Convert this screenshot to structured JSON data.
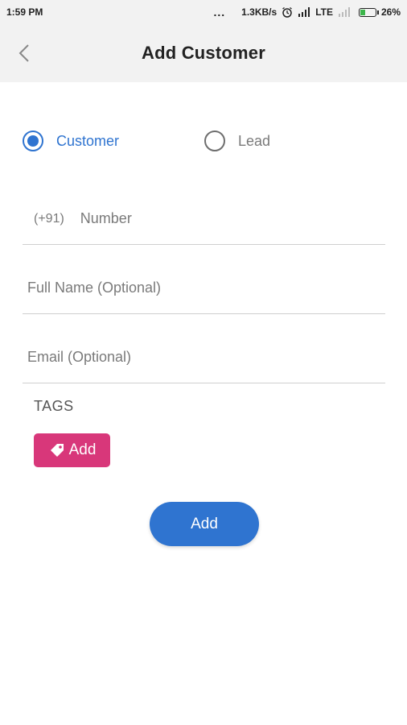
{
  "status_bar": {
    "time": "1:59 PM",
    "dots": "...",
    "speed": "1.3KB/s",
    "network": "LTE",
    "battery": "26%"
  },
  "header": {
    "title": "Add Customer"
  },
  "customer_type": {
    "options": [
      {
        "label": "Customer",
        "selected": true
      },
      {
        "label": "Lead",
        "selected": false
      }
    ]
  },
  "form": {
    "phone_prefix": "(+91)",
    "phone_placeholder": "Number",
    "name_placeholder": "Full Name (Optional)",
    "email_placeholder": "Email (Optional)"
  },
  "tags": {
    "heading": "TAGS",
    "add_label": "Add"
  },
  "submit": {
    "label": "Add"
  },
  "colors": {
    "accent": "#2f74d0",
    "tag": "#d8377a",
    "header_bg": "#f2f2f2"
  }
}
